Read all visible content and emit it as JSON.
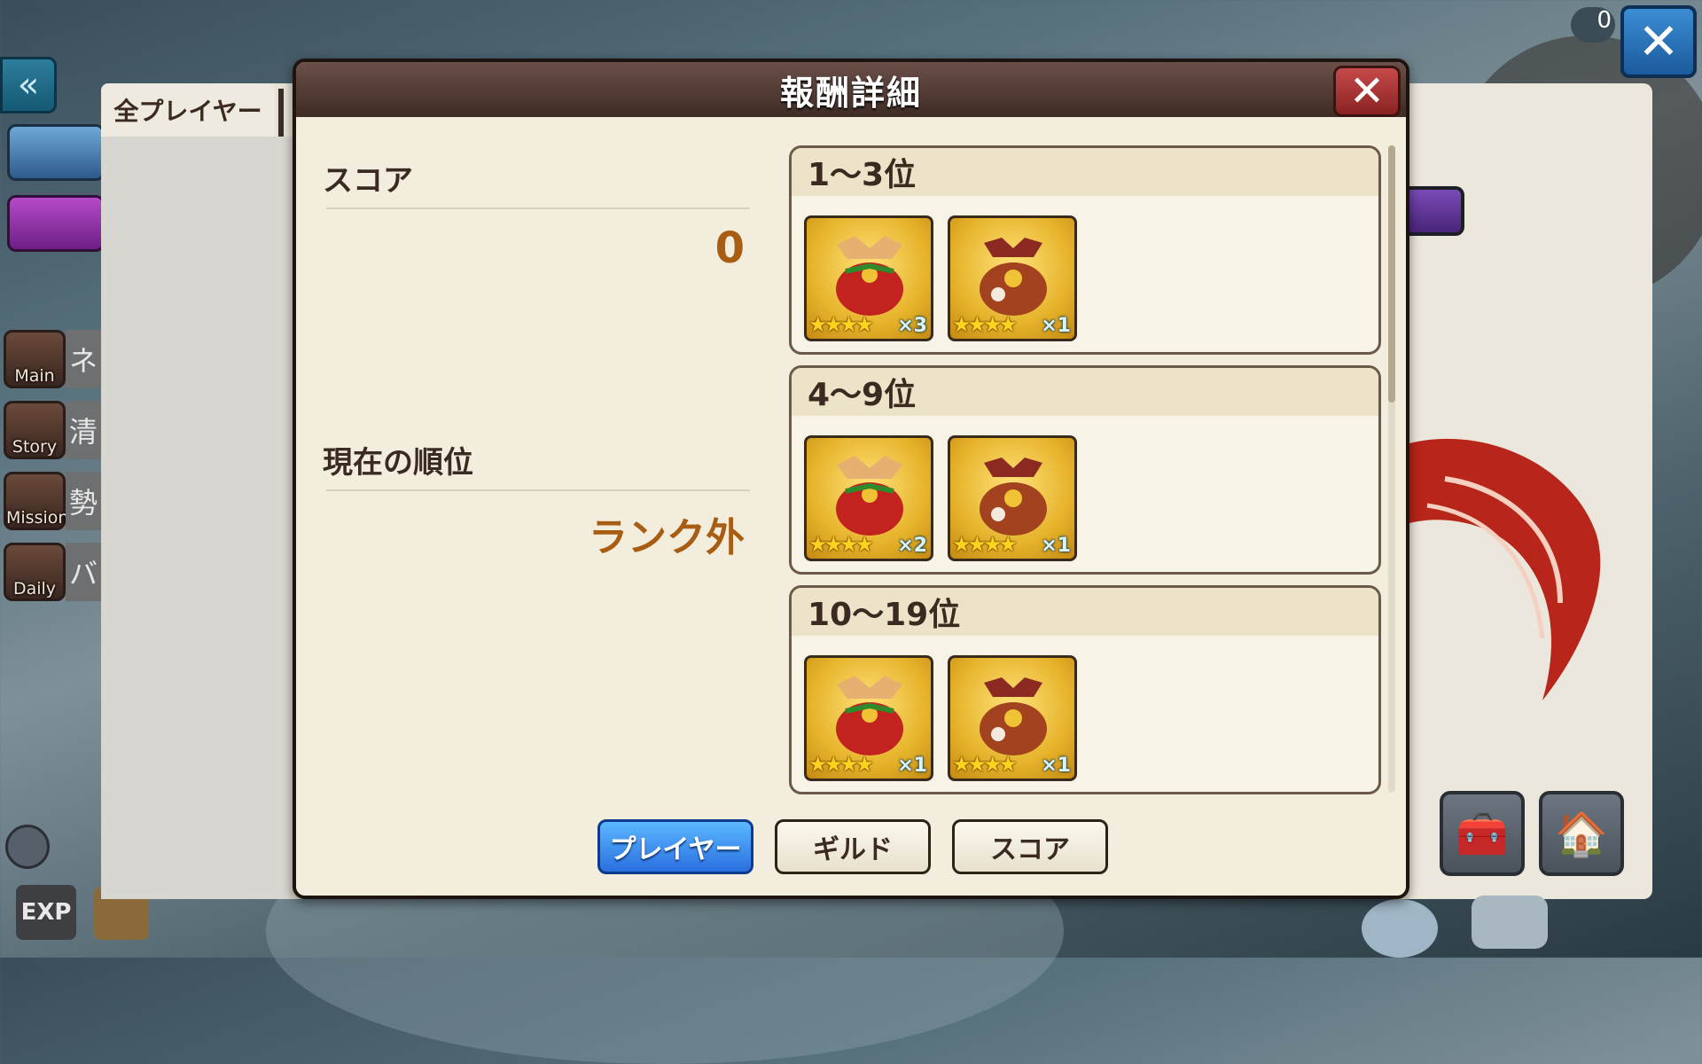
{
  "background": {
    "tab_all_players": "全プレイヤー",
    "side_menu": [
      {
        "caption": "Main",
        "tag": "ネ"
      },
      {
        "caption": "Story",
        "tag": "清"
      },
      {
        "caption": "Mission",
        "tag": "勢"
      },
      {
        "caption": "Daily",
        "tag": "バ"
      }
    ],
    "exp_label": "EXP",
    "clock_text": "0"
  },
  "dialog": {
    "title": "報酬詳細",
    "close_glyph": "✕",
    "score_label": "スコア",
    "score_value": "0",
    "rank_label": "現在の順位",
    "rank_value": "ランク外",
    "rewards": [
      {
        "range": "1〜3位",
        "items": [
          {
            "type": "red-bag",
            "stars": "★★★★",
            "qty": "×3"
          },
          {
            "type": "brown-bag",
            "stars": "★★★★",
            "qty": "×1"
          }
        ]
      },
      {
        "range": "4〜9位",
        "items": [
          {
            "type": "red-bag",
            "stars": "★★★★",
            "qty": "×2"
          },
          {
            "type": "brown-bag",
            "stars": "★★★★",
            "qty": "×1"
          }
        ]
      },
      {
        "range": "10〜19位",
        "items": [
          {
            "type": "red-bag",
            "stars": "★★★★",
            "qty": "×1"
          },
          {
            "type": "brown-bag",
            "stars": "★★★★",
            "qty": "×1"
          }
        ]
      }
    ],
    "buttons": {
      "player": "プレイヤー",
      "guild": "ギルド",
      "score": "スコア"
    },
    "active_button": "player"
  },
  "colors": {
    "accent_blue": "#2a6fe0",
    "value_brown": "#a85d12",
    "header_brown": "#4a352d"
  }
}
